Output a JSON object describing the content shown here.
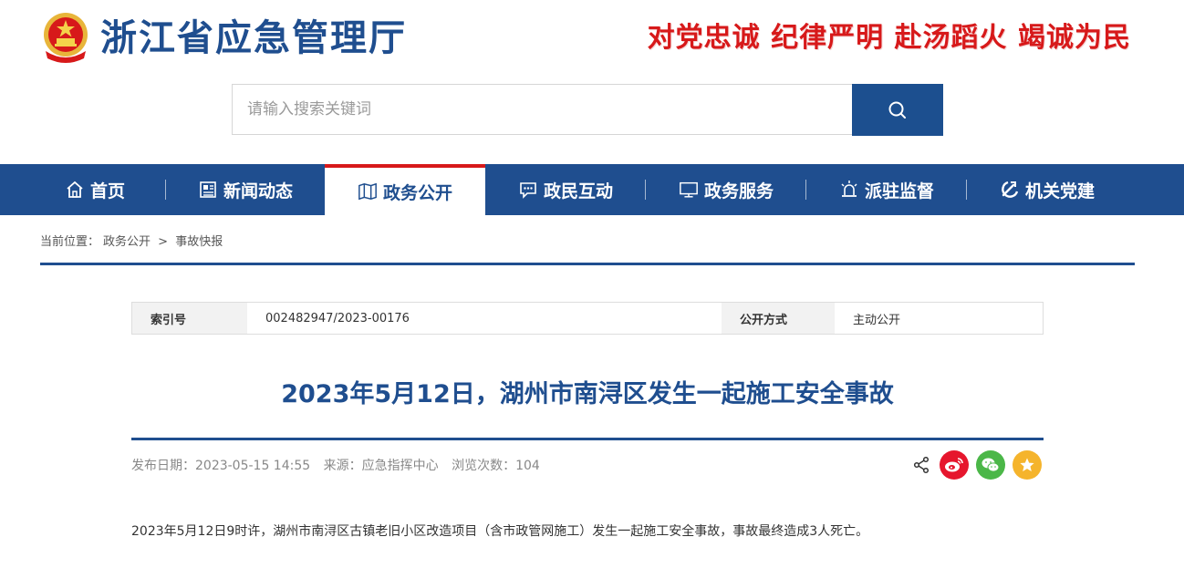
{
  "header": {
    "site_title": "浙江省应急管理厅",
    "slogan": "对党忠诚 纪律严明 赴汤蹈火 竭诚为民",
    "emblem_icon": "national-emblem-icon"
  },
  "search": {
    "placeholder": "请输入搜索关键词",
    "button_icon": "search-icon"
  },
  "nav": {
    "items": [
      {
        "label": "首页",
        "icon": "home-icon"
      },
      {
        "label": "新闻动态",
        "icon": "newspaper-icon"
      },
      {
        "label": "政务公开",
        "icon": "book-icon",
        "active": true
      },
      {
        "label": "政民互动",
        "icon": "chat-icon"
      },
      {
        "label": "政务服务",
        "icon": "monitor-icon"
      },
      {
        "label": "派驻监督",
        "icon": "alarm-icon"
      },
      {
        "label": "机关党建",
        "icon": "party-emblem-icon"
      }
    ]
  },
  "breadcrumb": {
    "prefix": "当前位置：",
    "level1": "政务公开",
    "separator": ">",
    "level2": "事故快报"
  },
  "info": {
    "index_label": "索引号",
    "index_value": "002482947/2023-00176",
    "method_label": "公开方式",
    "method_value": "主动公开"
  },
  "article": {
    "title": "2023年5月12日，湖州市南浔区发生一起施工安全事故",
    "publish": "发布日期：2023-05-15 14:55",
    "source": "来源：应急指挥中心",
    "views": "浏览次数：104",
    "body": "2023年5月12日9时许，湖州市南浔区古镇老旧小区改造项目（含市政管网施工）发生一起施工安全事故，事故最终造成3人死亡。"
  },
  "share": {
    "icons": [
      "share-icon",
      "weibo-icon",
      "wechat-icon",
      "favorite-icon"
    ]
  },
  "colors": {
    "brand_blue": "#1f4e8f",
    "accent_red": "#d7191a",
    "weibo_red": "#e6162d",
    "wechat_green": "#4bb748",
    "favorite_orange": "#f5b42c"
  }
}
